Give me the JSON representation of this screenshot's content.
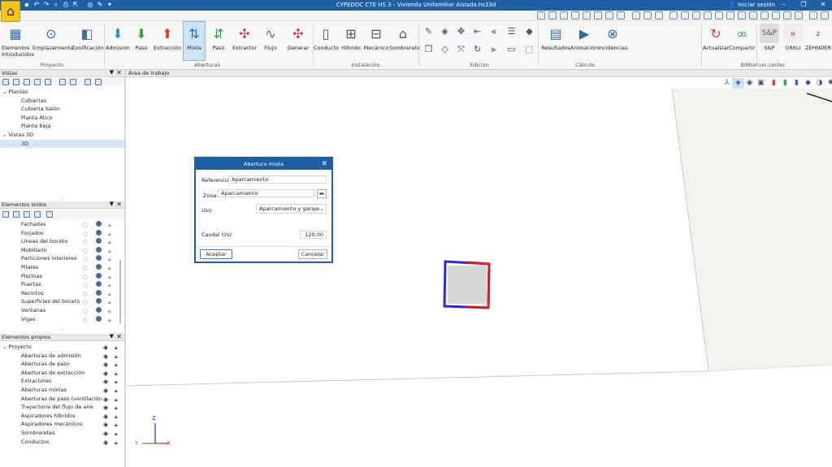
{
  "window": {
    "title": "CYPEDOC CTE HS 3 - Vivienda Unifamiliar Aislada.hs33d",
    "login": "Iniciar sesión",
    "app_icon": "house-icon"
  },
  "ribbon": {
    "buttons": [
      {
        "label": "Elementos introducidos",
        "icon": "grid-icon"
      },
      {
        "label": "Emplazamiento",
        "icon": "location-pin-icon"
      },
      {
        "label": "Zonificación",
        "icon": "cubes-icon"
      },
      {
        "label": "Admisión",
        "icon": "arrow-down-icon"
      },
      {
        "label": "Paso",
        "icon": "arrow-down-green-icon"
      },
      {
        "label": "Extracción",
        "icon": "arrow-up-red-icon"
      },
      {
        "label": "Mixta",
        "icon": "arrows-updown-icon"
      },
      {
        "label": "Paso",
        "icon": "arrows-pass-icon"
      },
      {
        "label": "Extractor",
        "icon": "fan-icon"
      },
      {
        "label": "Flujo",
        "icon": "flow-icon"
      },
      {
        "label": "Generar",
        "icon": "generate-fan-icon"
      },
      {
        "label": "Conducto",
        "icon": "duct-icon"
      },
      {
        "label": "Híbrido",
        "icon": "hybrid-icon"
      },
      {
        "label": "Mecánico",
        "icon": "mechanical-icon"
      },
      {
        "label": "Sombrerete",
        "icon": "cowl-icon"
      },
      {
        "label": "Resultados",
        "icon": "results-icon"
      },
      {
        "label": "Animación",
        "icon": "animation-icon"
      },
      {
        "label": "Incidencias",
        "icon": "incidents-icon"
      },
      {
        "label": "Actualizar",
        "icon": "refresh-icon"
      },
      {
        "label": "Compartir",
        "icon": "share-icon"
      },
      {
        "label": "S&P",
        "icon": "sp-logo-icon"
      },
      {
        "label": "ORKLI",
        "icon": "orkli-logo-icon"
      },
      {
        "label": "ZEHNDER",
        "icon": "zehnder-logo-icon"
      }
    ],
    "groups": [
      "Proyecto",
      "Aberturas",
      "Instalación",
      "Edición",
      "Cálculo",
      "BIMserver.center"
    ]
  },
  "vistas": {
    "title": "Vistas",
    "tree": [
      {
        "label": "Plantas",
        "level": 0
      },
      {
        "label": "Cubiertas",
        "level": 1
      },
      {
        "label": "Cubierta Salón",
        "level": 1
      },
      {
        "label": "Planta Ático",
        "level": 1
      },
      {
        "label": "Planta baja",
        "level": 1
      },
      {
        "label": "Vistas 3D",
        "level": 0
      },
      {
        "label": "3D",
        "level": 1
      }
    ]
  },
  "elementos_leidos": {
    "title": "Elementos leídos",
    "items": [
      "Fachadas",
      "Forjados",
      "Líneas del boceto",
      "Mobiliario",
      "Particiones interiores",
      "Pilares",
      "Piscinas",
      "Puertas",
      "Recintos",
      "Superficies del boceto",
      "Ventanas",
      "Vigas"
    ]
  },
  "elementos_propios": {
    "title": "Elementos propios",
    "root": "Proyecto",
    "items": [
      "Aberturas de admisión",
      "Aberturas de paso",
      "Aberturas de extracción",
      "Extractores",
      "Aberturas mixtas",
      "Aberturas de paso (ventilación ...",
      "Trayectoria del flujo de aire",
      "Aspiradores híbridos",
      "Aspiradores mecánicos",
      "Sombreretes",
      "Conductos"
    ]
  },
  "workspace": {
    "title": "Área de trabajo",
    "axes": {
      "z": "Z",
      "y": "Y",
      "x": "X"
    }
  },
  "dialog": {
    "title": "Abertura mixta",
    "referencia_label": "Referencia",
    "referencia_value": "Aparcamiento",
    "zona_label": "Zona",
    "zona_value": "Aparcamiento",
    "uso_label": "Uso",
    "uso_value": "Aparcamiento y garaje",
    "caudal_label": "Caudal (l/s)",
    "caudal_value": "120.00",
    "accept": "Aceptar",
    "cancel": "Cancelar"
  }
}
